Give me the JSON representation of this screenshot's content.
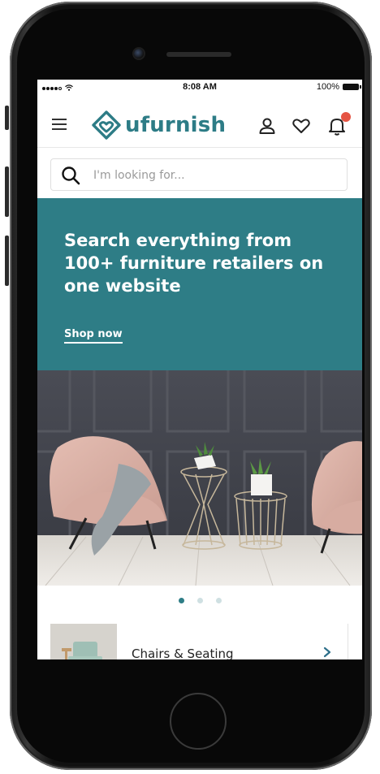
{
  "status_bar": {
    "time": "8:08 AM",
    "battery": "100%"
  },
  "header": {
    "brand": "ufurnish",
    "icons": [
      "menu-icon",
      "user-icon",
      "heart-icon",
      "bell-icon"
    ],
    "notification_color": "#e55443"
  },
  "search": {
    "placeholder": "I'm looking for..."
  },
  "hero": {
    "title": "Search everything from 100+ furniture retailers on one website",
    "cta": "Shop now",
    "background": "#2e7d86"
  },
  "carousel": {
    "total": 3,
    "active_index": 0
  },
  "categories": [
    {
      "label": "Chairs & Seating"
    }
  ],
  "colors": {
    "brand": "#2d7c86",
    "accent": "#2e7d86"
  }
}
